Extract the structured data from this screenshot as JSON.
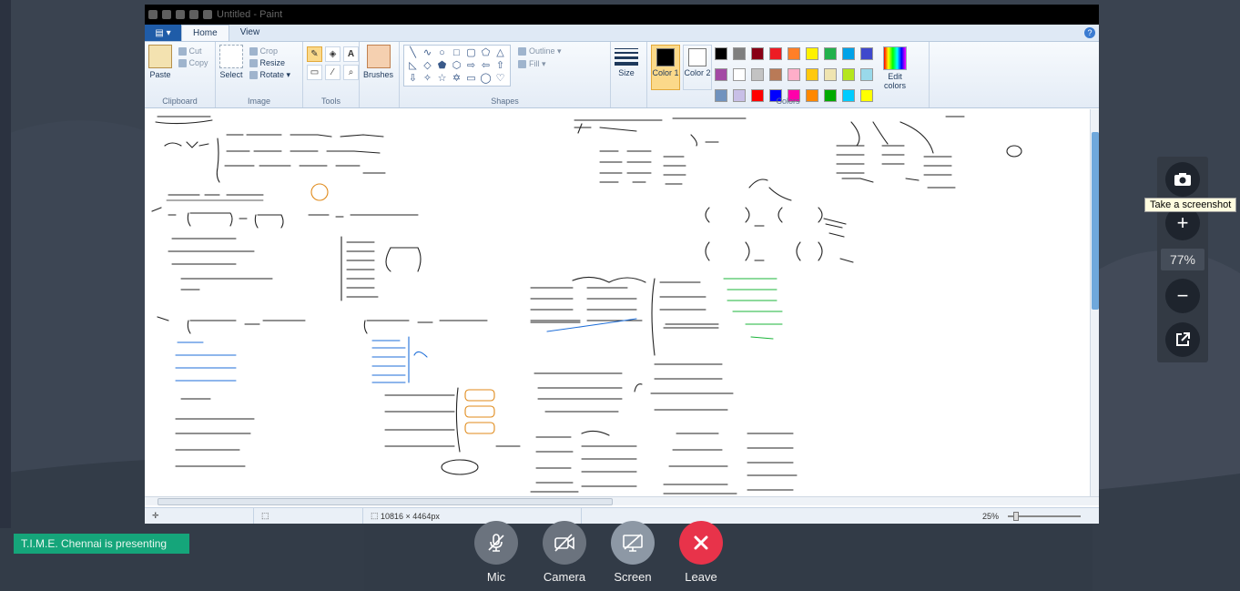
{
  "paint": {
    "title": "Untitled - Paint",
    "tabs": [
      {
        "label": "Home",
        "active": true
      },
      {
        "label": "View",
        "active": false
      }
    ],
    "groups": {
      "clipboard": {
        "label": "Clipboard",
        "paste": "Paste",
        "cut": "Cut",
        "copy": "Copy"
      },
      "image": {
        "label": "Image",
        "select": "Select",
        "crop": "Crop",
        "resize": "Resize",
        "rotate": "Rotate"
      },
      "tools": {
        "label": "Tools"
      },
      "brushes": {
        "label": "Brushes"
      },
      "shapes": {
        "label": "Shapes",
        "outline": "Outline",
        "fill": "Fill"
      },
      "size": {
        "label": "Size"
      },
      "colors": {
        "label": "Colors",
        "color1": "Color 1",
        "color2": "Color 2",
        "edit": "Edit colors",
        "palette": [
          "#000000",
          "#7f7f7f",
          "#880015",
          "#ed1c24",
          "#ff7f27",
          "#fff200",
          "#22b14c",
          "#00a2e8",
          "#3f48cc",
          "#a349a4",
          "#ffffff",
          "#c3c3c3",
          "#b97a57",
          "#ffaec9",
          "#ffc90e",
          "#efe4b0",
          "#b5e61d",
          "#99d9ea",
          "#7092be",
          "#c8bfe7",
          "#ff0000",
          "#0000ff",
          "#ff00aa",
          "#ff8800",
          "#00aa00",
          "#00ccff",
          "#ffff00",
          "#e0e0e0",
          "#f0f0f0",
          "#fafafa"
        ]
      }
    },
    "status": {
      "dimensions": "10816 × 4464px",
      "zoom": "25%"
    }
  },
  "zoom_panel": {
    "screenshot_tooltip": "Take a screenshot",
    "zoom_percent": "77%"
  },
  "presenter_badge": "T.I.M.E. Chennai is presenting",
  "controls": [
    {
      "label": "Mic",
      "state": "muted"
    },
    {
      "label": "Camera",
      "state": "off"
    },
    {
      "label": "Screen",
      "state": "sharing"
    },
    {
      "label": "Leave",
      "state": "danger"
    }
  ]
}
